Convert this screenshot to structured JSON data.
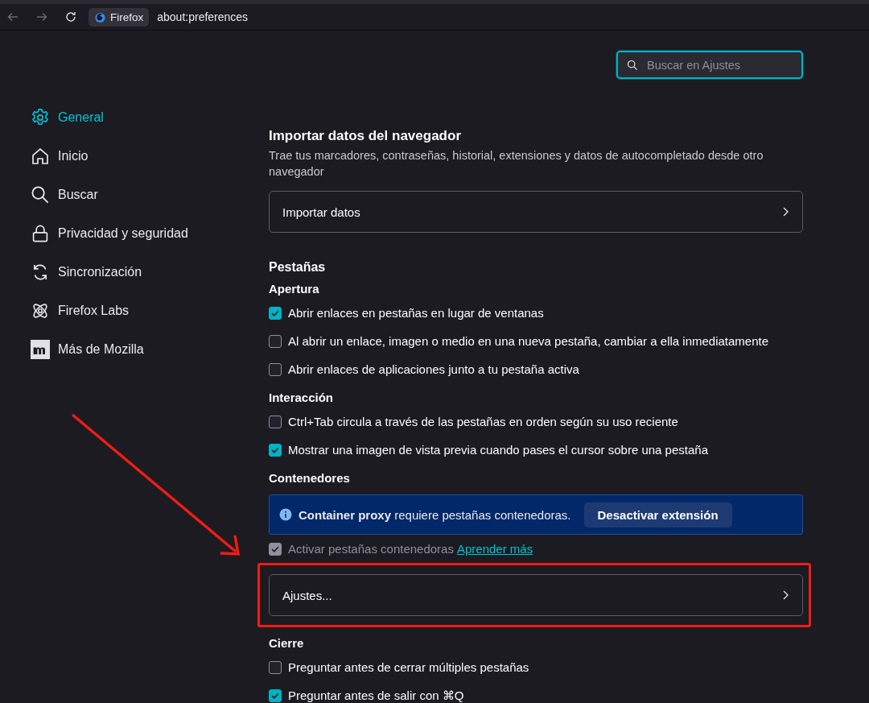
{
  "toolbar": {
    "identity_label": "Firefox",
    "url": "about:preferences"
  },
  "search": {
    "placeholder": "Buscar en Ajustes"
  },
  "sidebar": {
    "items": [
      {
        "label": "General",
        "selected": true
      },
      {
        "label": "Inicio",
        "selected": false
      },
      {
        "label": "Buscar",
        "selected": false
      },
      {
        "label": "Privacidad y seguridad",
        "selected": false
      },
      {
        "label": "Sincronización",
        "selected": false
      },
      {
        "label": "Firefox Labs",
        "selected": false
      },
      {
        "label": "Más de Mozilla",
        "selected": false
      }
    ]
  },
  "blocks": [
    {
      "kind": "title",
      "text": "Importar datos del navegador"
    },
    {
      "kind": "description",
      "text": "Trae tus marcadores, contraseñas, historial, extensiones y datos de autocompletado desde otro navegador"
    },
    {
      "kind": "box",
      "label": "Importar datos",
      "highlighted": false
    },
    {
      "kind": "section",
      "text": "Pestañas"
    },
    {
      "kind": "subheading",
      "text": "Apertura"
    },
    {
      "kind": "checkbox",
      "label": "Abrir enlaces en pestañas en lugar de ventanas",
      "checked": true,
      "disabled": false
    },
    {
      "kind": "checkbox",
      "label": "Al abrir un enlace, imagen o medio en una nueva pestaña, cambiar a ella inmediatamente",
      "checked": false,
      "disabled": false
    },
    {
      "kind": "checkbox",
      "label": "Abrir enlaces de aplicaciones junto a tu pestaña activa",
      "checked": false,
      "disabled": false
    },
    {
      "kind": "subheading",
      "text": "Interacción"
    },
    {
      "kind": "checkbox",
      "label": "Ctrl+Tab circula a través de las pestañas en orden según su uso reciente",
      "checked": false,
      "disabled": false
    },
    {
      "kind": "checkbox",
      "label": "Mostrar una imagen de vista previa cuando pases el cursor sobre una pestaña",
      "checked": true,
      "disabled": false
    },
    {
      "kind": "subheading",
      "text": "Contenedores"
    },
    {
      "kind": "notice",
      "text": "**Container proxy** requiere pestañas contenedoras.",
      "button": "Desactivar extensión"
    },
    {
      "kind": "checkbox",
      "label": "Activar pestañas contenedoras",
      "checked": true,
      "disabled": true,
      "link": "Aprender más"
    },
    {
      "kind": "box",
      "label": "Ajustes...",
      "highlighted": true
    },
    {
      "kind": "subheading",
      "text": "Cierre"
    },
    {
      "kind": "checkbox",
      "label": "Preguntar antes de cerrar múltiples pestañas",
      "checked": false,
      "disabled": false
    },
    {
      "kind": "checkbox",
      "label": "Preguntar antes de salir con ⌘Q",
      "checked": true,
      "disabled": false
    }
  ]
}
